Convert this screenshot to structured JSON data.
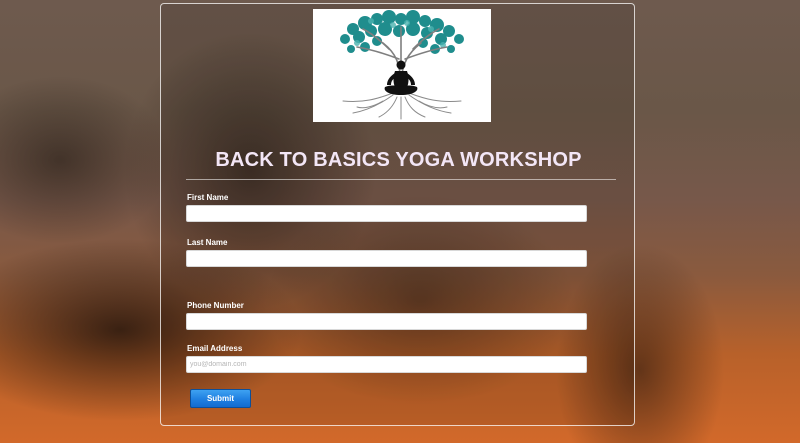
{
  "page": {
    "title": "BACK TO BASICS YOGA WORKSHOP"
  },
  "logo": {
    "icon": "tree-meditation-logo"
  },
  "form": {
    "first_name": {
      "label": "First Name",
      "value": "",
      "placeholder": ""
    },
    "last_name": {
      "label": "Last Name",
      "value": "",
      "placeholder": ""
    },
    "phone": {
      "label": "Phone Number",
      "value": "",
      "placeholder": ""
    },
    "email": {
      "label": "Email Address",
      "value": "",
      "placeholder": "you@domain.com"
    },
    "submit_label": "Submit"
  },
  "colors": {
    "title": "#f3e6f6",
    "button": "#1f7fe0",
    "tree_leaves": "#1f8d8d"
  }
}
